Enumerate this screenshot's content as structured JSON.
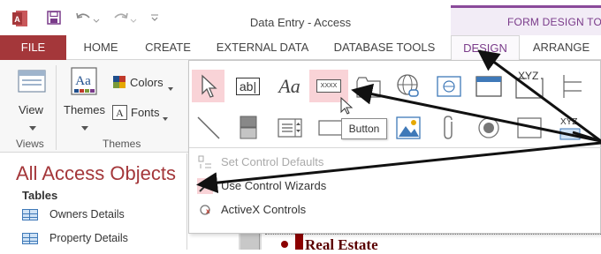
{
  "titlebar": {
    "title": "Data Entry - Access",
    "context_label": "FORM DESIGN TOO",
    "undo_icon": "undo-icon",
    "redo_icon": "redo-icon",
    "save_icon": "save-icon"
  },
  "tabs": [
    {
      "label": "FILE"
    },
    {
      "label": "HOME"
    },
    {
      "label": "CREATE"
    },
    {
      "label": "EXTERNAL DATA"
    },
    {
      "label": "DATABASE TOOLS"
    },
    {
      "label": "DESIGN"
    },
    {
      "label": "ARRANGE"
    }
  ],
  "ribbon": {
    "views_group": "Views",
    "view_button": "View",
    "themes_group": "Themes",
    "themes_button": "Themes",
    "colors_button": "Colors",
    "fonts_button": "Fonts"
  },
  "gallery": {
    "tooltip": "Button",
    "text_label_glyph": "Aa",
    "textbox_glyph": "ab|",
    "button_glyph": "XXXX",
    "xyz_glyph": "XYZ",
    "menu": [
      {
        "label": "Set Control Defaults",
        "disabled": true
      },
      {
        "label": "Use Control Wizards",
        "disabled": false
      },
      {
        "label": "ActiveX Controls",
        "disabled": false
      }
    ]
  },
  "nav": {
    "title": "All Access Objects",
    "section": "Tables",
    "items": [
      {
        "label": "Owners Details"
      },
      {
        "label": "Property Details"
      }
    ]
  },
  "form": {
    "label": "Real Estate"
  },
  "colors": {
    "access_brand": "#a4373a",
    "context_accent": "#7a3b8a",
    "selection": "#f9d3d7"
  }
}
